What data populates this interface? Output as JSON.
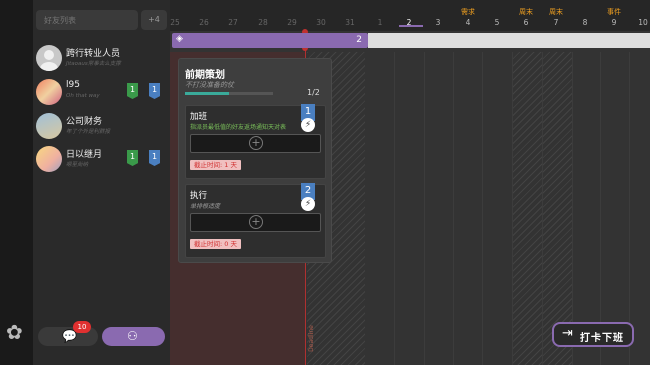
{
  "sidebar": {
    "search_placeholder": "好友列表",
    "more_count": "+4",
    "contacts": [
      {
        "name": "跨行转业人员",
        "subtitle": "Jitaoaus常事去么支撑",
        "badges": []
      },
      {
        "name": "l95",
        "subtitle": "Oh that way",
        "badges": [
          "1",
          "1"
        ]
      },
      {
        "name": "公司财务",
        "subtitle": "年了个外是利群报",
        "badges": []
      },
      {
        "name": "日以继月",
        "subtitle": "嗯至尚纳",
        "badges": [
          "1",
          "1"
        ]
      }
    ],
    "chat_badge": "10"
  },
  "timeline": {
    "days": [
      "25",
      "26",
      "27",
      "28",
      "29",
      "30",
      "31",
      "1",
      "2",
      "3",
      "4",
      "5",
      "6",
      "7",
      "8",
      "9",
      "10"
    ],
    "today": "2",
    "events": [
      {
        "label": "需求",
        "day": "4"
      },
      {
        "label": "周末",
        "day": "6"
      },
      {
        "label": "周末",
        "day": "7"
      },
      {
        "label": "事件",
        "day": "9"
      }
    ],
    "task_bar_count": "2",
    "deadline_label": "Deadline"
  },
  "task": {
    "title": "前期策划",
    "description": "不打没准备的仗",
    "progress_text": "1/2",
    "progress": 0.5,
    "subtasks": [
      {
        "title": "加班",
        "description": "指派员最低值的好友返场通知天对表",
        "number": "1",
        "deadline_prefix": "截止时间:",
        "deadline_value": "1",
        "deadline_unit": "天"
      },
      {
        "title": "执行",
        "description": "单排根适度",
        "number": "2",
        "deadline_prefix": "截止时间:",
        "deadline_value": "0",
        "deadline_unit": "天"
      }
    ]
  },
  "punch_button": {
    "label": "打卡下班"
  },
  "colors": {
    "accent": "#8a6ab0",
    "event": "#f0a020",
    "deadline": "#c03030"
  }
}
